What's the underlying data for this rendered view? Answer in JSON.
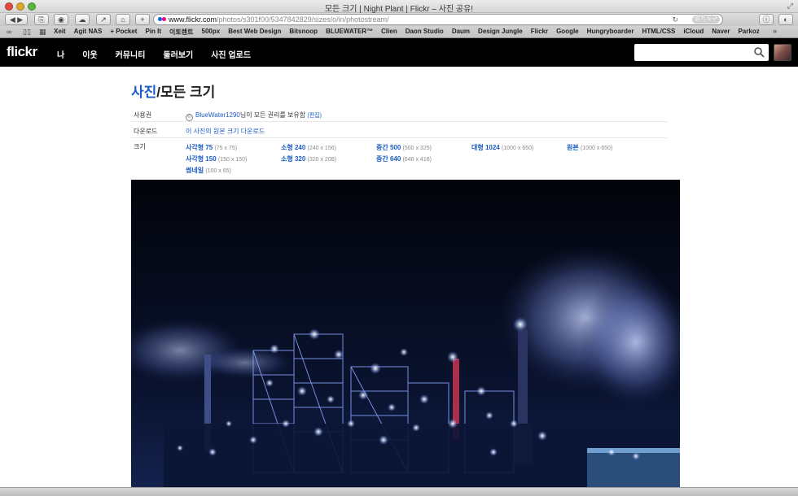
{
  "window": {
    "title": "모든 크기 | Night Plant | Flickr – 사진 공유!"
  },
  "toolbar": {
    "url_domain": "www.flickr.com",
    "url_path": "/photos/s301f00/5347842829/sizes/o/in/photostream/",
    "reader_label": "읽기 도구",
    "back_icon": "back-arrow-icon",
    "forward_icon": "forward-arrow-icon"
  },
  "bookmarks": {
    "items": [
      "Xeit",
      "Agit NAS",
      "+ Pocket",
      "Pin It",
      "이토렌트",
      "500px",
      "Best Web Design",
      "Bitsnoop",
      "BLUEWATER™",
      "Clien",
      "Daon Studio",
      "Daum",
      "Design Jungle",
      "Flickr",
      "Google",
      "Hungryboarder",
      "HTML/CSS",
      "iCloud",
      "Naver",
      "Parkoz"
    ],
    "more": "»"
  },
  "flickr": {
    "logo": "flickr",
    "nav": [
      "나",
      "이웃",
      "커뮤니티",
      "둘러보기",
      "사진 업로드"
    ]
  },
  "page": {
    "title_link": "사진",
    "title_rest": "/모든 크기",
    "license_label": "사용권",
    "owner": "BlueWater1290",
    "rights_text": "님이 모든 권리를 보유함",
    "edit_text": "(편집)",
    "download_label": "다운로드",
    "download_link": "이 사진의 원본 크기 다운로드",
    "sizes_label": "크기",
    "sizes": [
      [
        {
          "name": "사각형 75",
          "dim": "(75 x 75)"
        },
        {
          "name": "사각형 150",
          "dim": "(150 x 150)"
        },
        {
          "name": "썸네일",
          "dim": "(100 x 65)"
        }
      ],
      [
        {
          "name": "소형 240",
          "dim": "(240 x 156)"
        },
        {
          "name": "소형 320",
          "dim": "(320 x 208)"
        }
      ],
      [
        {
          "name": "중간 500",
          "dim": "(500 x 325)"
        },
        {
          "name": "중간 640",
          "dim": "(640 x 416)"
        }
      ],
      [
        {
          "name": "대형 1024",
          "dim": "(1000 x 650)"
        }
      ],
      [
        {
          "name": "원본",
          "dim": "(1000 x 650)"
        }
      ]
    ]
  },
  "colors": {
    "link": "#1b5cc4",
    "topbar": "#000000",
    "photo_bg": "#04060d"
  }
}
